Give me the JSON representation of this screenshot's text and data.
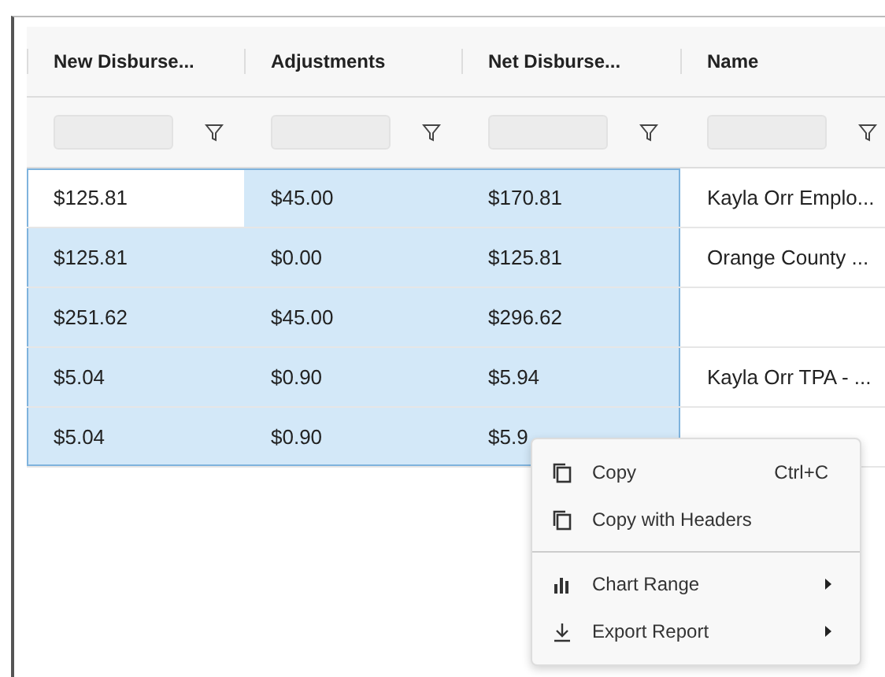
{
  "table": {
    "columns": [
      {
        "label": "New Disburse..."
      },
      {
        "label": "Adjustments"
      },
      {
        "label": "Net Disburse..."
      },
      {
        "label": "Name"
      }
    ],
    "rows": [
      {
        "cells": [
          {
            "text": "$125.81",
            "selected": false
          },
          {
            "text": "$45.00",
            "selected": true
          },
          {
            "text": "$170.81",
            "selected": true
          },
          {
            "text": "Kayla Orr Emplo...",
            "selected": false
          }
        ]
      },
      {
        "cells": [
          {
            "text": "$125.81",
            "selected": true
          },
          {
            "text": "$0.00",
            "selected": true
          },
          {
            "text": "$125.81",
            "selected": true
          },
          {
            "text": "Orange County ...",
            "selected": false
          }
        ]
      },
      {
        "cells": [
          {
            "text": "$251.62",
            "selected": true
          },
          {
            "text": "$45.00",
            "selected": true
          },
          {
            "text": "$296.62",
            "selected": true
          },
          {
            "selected": false
          }
        ]
      },
      {
        "cells": [
          {
            "text": "$5.04",
            "selected": true
          },
          {
            "text": "$0.90",
            "selected": true
          },
          {
            "text": "$5.94",
            "selected": true
          },
          {
            "text": "Kayla Orr TPA - ...",
            "selected": false
          }
        ]
      },
      {
        "cells": [
          {
            "text": "$5.04",
            "selected": true
          },
          {
            "text": "$0.90",
            "selected": true
          },
          {
            "text": "$5.9",
            "selected": true
          },
          {
            "selected": false
          }
        ]
      }
    ]
  },
  "context_menu": {
    "items": [
      {
        "kind": "item",
        "label": "Copy",
        "shortcut": "Ctrl+C"
      },
      {
        "kind": "item",
        "label": "Copy with Headers"
      },
      {
        "kind": "separator"
      },
      {
        "kind": "submenu",
        "label": "Chart Range"
      },
      {
        "kind": "submenu",
        "label": "Export Report"
      }
    ]
  }
}
